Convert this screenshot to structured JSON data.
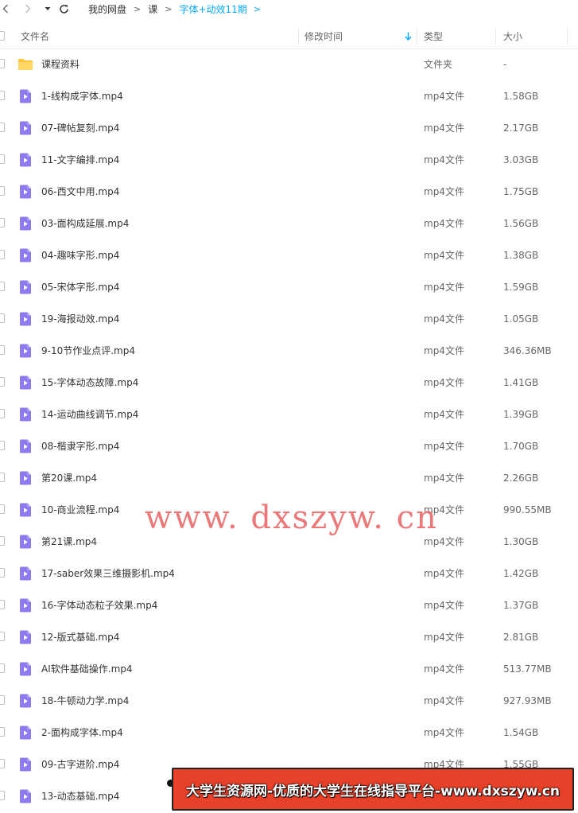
{
  "breadcrumb": [
    "我的网盘",
    "课",
    "字体+动效11期"
  ],
  "header": {
    "name": "文件名",
    "modified": "修改时间",
    "type": "类型",
    "size": "大小"
  },
  "colors": {
    "accent": "#06a7ff",
    "folder": "#ffc53d",
    "video": "#8c7cf0",
    "watermark": "#e96a6a",
    "banner": "#e8412a"
  },
  "rows": [
    {
      "kind": "folder",
      "name": "课程资料",
      "type": "文件夹",
      "size": "-"
    },
    {
      "kind": "video",
      "name": "1-线构成字体.mp4",
      "type": "mp4文件",
      "size": "1.58GB"
    },
    {
      "kind": "video",
      "name": "07-碑帖复刻.mp4",
      "type": "mp4文件",
      "size": "2.17GB"
    },
    {
      "kind": "video",
      "name": "11-文字编排.mp4",
      "type": "mp4文件",
      "size": "3.03GB"
    },
    {
      "kind": "video",
      "name": "06-西文中用.mp4",
      "type": "mp4文件",
      "size": "1.75GB"
    },
    {
      "kind": "video",
      "name": "03-面构成延展.mp4",
      "type": "mp4文件",
      "size": "1.56GB"
    },
    {
      "kind": "video",
      "name": "04-趣味字形.mp4",
      "type": "mp4文件",
      "size": "1.38GB"
    },
    {
      "kind": "video",
      "name": "05-宋体字形.mp4",
      "type": "mp4文件",
      "size": "1.59GB"
    },
    {
      "kind": "video",
      "name": "19-海报动效.mp4",
      "type": "mp4文件",
      "size": "1.05GB"
    },
    {
      "kind": "video",
      "name": "9-10节作业点评.mp4",
      "type": "mp4文件",
      "size": "346.36MB"
    },
    {
      "kind": "video",
      "name": "15-字体动态故障.mp4",
      "type": "mp4文件",
      "size": "1.41GB"
    },
    {
      "kind": "video",
      "name": "14-运动曲线调节.mp4",
      "type": "mp4文件",
      "size": "1.39GB"
    },
    {
      "kind": "video",
      "name": "08-楷隶字形.mp4",
      "type": "mp4文件",
      "size": "1.70GB"
    },
    {
      "kind": "video",
      "name": "第20课.mp4",
      "type": "mp4文件",
      "size": "2.26GB"
    },
    {
      "kind": "video",
      "name": "10-商业流程.mp4",
      "type": "mp4文件",
      "size": "990.55MB"
    },
    {
      "kind": "video",
      "name": "第21课.mp4",
      "type": "mp4文件",
      "size": "1.30GB"
    },
    {
      "kind": "video",
      "name": "17-saber效果三维摄影机.mp4",
      "type": "mp4文件",
      "size": "1.42GB"
    },
    {
      "kind": "video",
      "name": "16-字体动态粒子效果.mp4",
      "type": "mp4文件",
      "size": "1.37GB"
    },
    {
      "kind": "video",
      "name": "12-版式基础.mp4",
      "type": "mp4文件",
      "size": "2.81GB"
    },
    {
      "kind": "video",
      "name": "AI软件基础操作.mp4",
      "type": "mp4文件",
      "size": "513.77MB"
    },
    {
      "kind": "video",
      "name": "18-牛顿动力学.mp4",
      "type": "mp4文件",
      "size": "927.93MB"
    },
    {
      "kind": "video",
      "name": "2-面构成字体.mp4",
      "type": "mp4文件",
      "size": "1.54GB"
    },
    {
      "kind": "video",
      "name": "09-古字进阶.mp4",
      "type": "mp4文件",
      "size": "1.55GB"
    },
    {
      "kind": "video",
      "name": "13-动态基础.mp4",
      "type": "mp4文件",
      "size": ""
    }
  ],
  "watermark": "www. dxszyw. cn",
  "banner": "大学生资源网-优质的大学生在线指导平台-www.dxszyw.cn"
}
